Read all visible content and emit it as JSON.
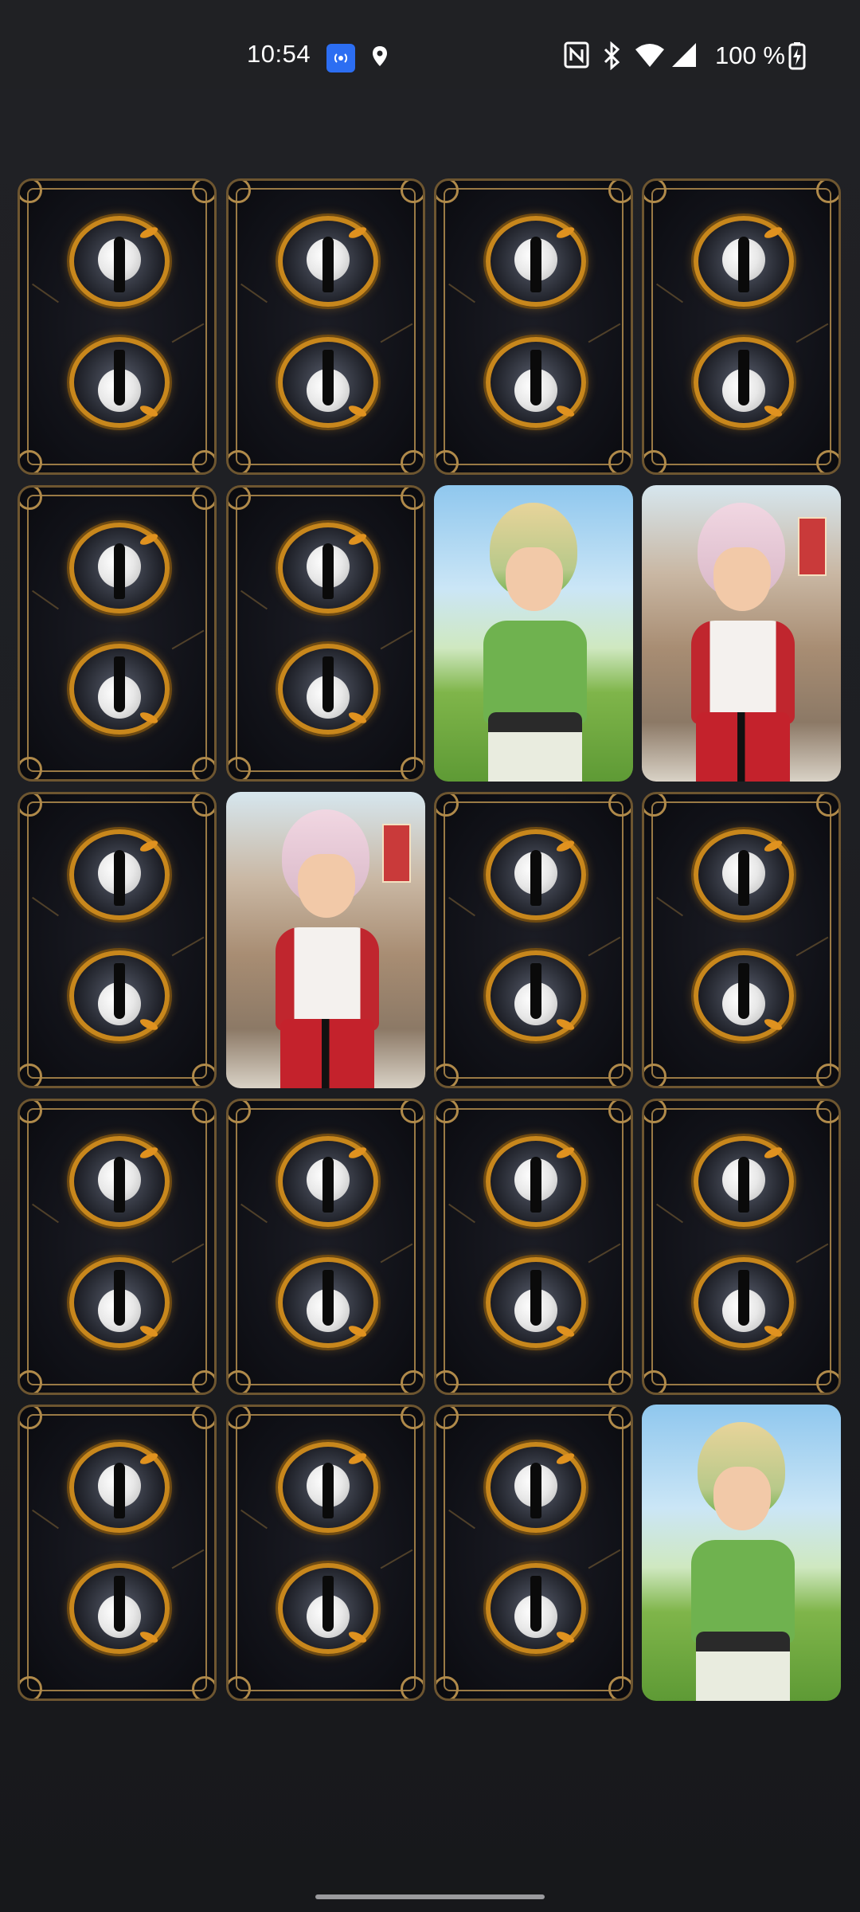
{
  "status_bar": {
    "time": "10:54",
    "battery": "100 %",
    "icons": [
      "hotspot-icon",
      "location-icon",
      "nfc-icon",
      "bluetooth-icon",
      "wifi-icon",
      "cell-signal-icon",
      "battery-charging-icon"
    ]
  },
  "board": {
    "rows": 5,
    "columns": 4,
    "cards": [
      {
        "state": "face-down"
      },
      {
        "state": "face-down"
      },
      {
        "state": "face-down"
      },
      {
        "state": "face-down"
      },
      {
        "state": "face-down"
      },
      {
        "state": "face-down"
      },
      {
        "state": "face-up",
        "art": "girl-green-top"
      },
      {
        "state": "face-up",
        "art": "girl-red-outfit"
      },
      {
        "state": "face-down"
      },
      {
        "state": "face-up",
        "art": "girl-red-outfit"
      },
      {
        "state": "face-down"
      },
      {
        "state": "face-down"
      },
      {
        "state": "face-down"
      },
      {
        "state": "face-down"
      },
      {
        "state": "face-down"
      },
      {
        "state": "face-down"
      },
      {
        "state": "face-down"
      },
      {
        "state": "face-down"
      },
      {
        "state": "face-down"
      },
      {
        "state": "face-up",
        "art": "girl-green-top"
      }
    ]
  },
  "colors": {
    "card_border": "#6e5630",
    "emblem_ring": "#c8871c",
    "background": "#1c1d20"
  }
}
